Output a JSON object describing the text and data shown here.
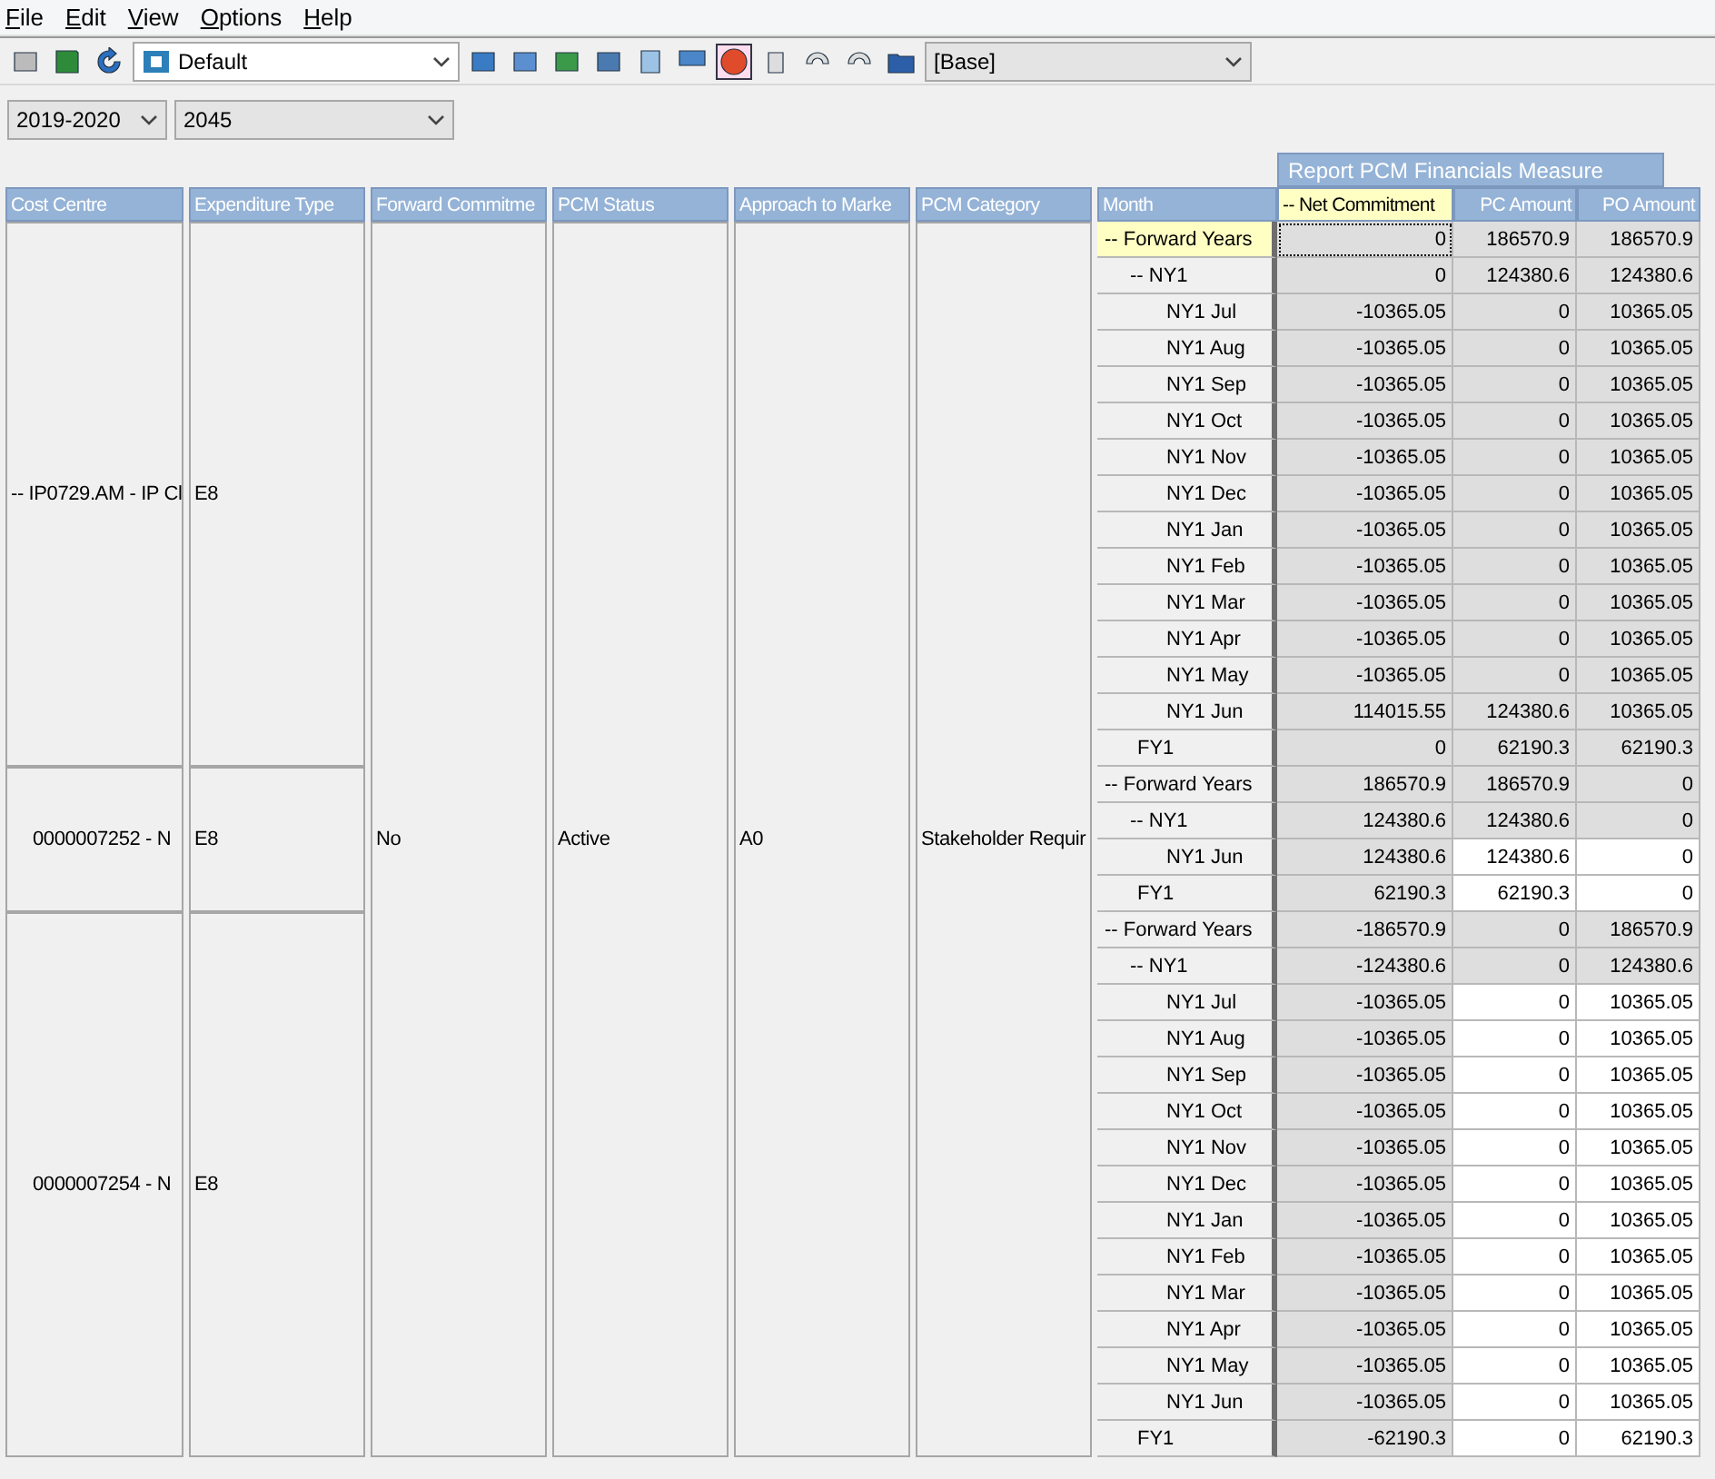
{
  "menu": [
    "File",
    "Edit",
    "View",
    "Options",
    "Help"
  ],
  "toolbar": {
    "view": "Default",
    "scenario": "[Base]"
  },
  "filters": [
    "2019-2020",
    "2045"
  ],
  "measure_header": "Report PCM Financials Measure",
  "columns": [
    "Cost Centre",
    "Expenditure Type",
    "Forward Commitme",
    "PCM Status",
    "Approach to Marke",
    "PCM Category",
    "Month",
    "-- Net Commitment",
    "PC Amount",
    "PO Amount"
  ],
  "forward_commitment": "No",
  "pcm_status": "Active",
  "approach": "A0",
  "category": "Stakeholder Requir",
  "groups": [
    {
      "cost_centre": "-- IP0729.AM - IP Cl",
      "expenditure_type": "E8",
      "rows": [
        {
          "kind": "total",
          "month": "-- Forward Years",
          "net": "0",
          "pc": "186570.9",
          "po": "186570.9",
          "editable": false,
          "selected": true
        },
        {
          "kind": "year",
          "month": "-- NY1",
          "net": "0",
          "pc": "124380.6",
          "po": "124380.6",
          "editable": false,
          "selected": false
        },
        {
          "kind": "month",
          "month": "NY1 Jul",
          "net": "-10365.05",
          "pc": "0",
          "po": "10365.05",
          "editable": false,
          "selected": false
        },
        {
          "kind": "month",
          "month": "NY1 Aug",
          "net": "-10365.05",
          "pc": "0",
          "po": "10365.05",
          "editable": false,
          "selected": false
        },
        {
          "kind": "month",
          "month": "NY1 Sep",
          "net": "-10365.05",
          "pc": "0",
          "po": "10365.05",
          "editable": false,
          "selected": false
        },
        {
          "kind": "month",
          "month": "NY1 Oct",
          "net": "-10365.05",
          "pc": "0",
          "po": "10365.05",
          "editable": false,
          "selected": false
        },
        {
          "kind": "month",
          "month": "NY1 Nov",
          "net": "-10365.05",
          "pc": "0",
          "po": "10365.05",
          "editable": false,
          "selected": false
        },
        {
          "kind": "month",
          "month": "NY1 Dec",
          "net": "-10365.05",
          "pc": "0",
          "po": "10365.05",
          "editable": false,
          "selected": false
        },
        {
          "kind": "month",
          "month": "NY1 Jan",
          "net": "-10365.05",
          "pc": "0",
          "po": "10365.05",
          "editable": false,
          "selected": false
        },
        {
          "kind": "month",
          "month": "NY1 Feb",
          "net": "-10365.05",
          "pc": "0",
          "po": "10365.05",
          "editable": false,
          "selected": false
        },
        {
          "kind": "month",
          "month": "NY1 Mar",
          "net": "-10365.05",
          "pc": "0",
          "po": "10365.05",
          "editable": false,
          "selected": false
        },
        {
          "kind": "month",
          "month": "NY1 Apr",
          "net": "-10365.05",
          "pc": "0",
          "po": "10365.05",
          "editable": false,
          "selected": false
        },
        {
          "kind": "month",
          "month": "NY1 May",
          "net": "-10365.05",
          "pc": "0",
          "po": "10365.05",
          "editable": false,
          "selected": false
        },
        {
          "kind": "month",
          "month": "NY1 Jun",
          "net": "114015.55",
          "pc": "124380.6",
          "po": "10365.05",
          "editable": false,
          "selected": false
        },
        {
          "kind": "fy",
          "month": "FY1",
          "net": "0",
          "pc": "62190.3",
          "po": "62190.3",
          "editable": false,
          "selected": false
        }
      ]
    },
    {
      "cost_centre": "0000007252 - N",
      "expenditure_type": "E8",
      "rows": [
        {
          "kind": "total",
          "month": "-- Forward Years",
          "net": "186570.9",
          "pc": "186570.9",
          "po": "0",
          "editable": false,
          "selected": false
        },
        {
          "kind": "year",
          "month": "-- NY1",
          "net": "124380.6",
          "pc": "124380.6",
          "po": "0",
          "editable": false,
          "selected": false
        },
        {
          "kind": "month",
          "month": "NY1 Jun",
          "net": "124380.6",
          "pc": "124380.6",
          "po": "0",
          "editable": true,
          "selected": false
        },
        {
          "kind": "fy",
          "month": "FY1",
          "net": "62190.3",
          "pc": "62190.3",
          "po": "0",
          "editable": true,
          "selected": false
        }
      ]
    },
    {
      "cost_centre": "0000007254 - N",
      "expenditure_type": "E8",
      "rows": [
        {
          "kind": "total",
          "month": "-- Forward Years",
          "net": "-186570.9",
          "pc": "0",
          "po": "186570.9",
          "editable": false,
          "selected": false
        },
        {
          "kind": "year",
          "month": "-- NY1",
          "net": "-124380.6",
          "pc": "0",
          "po": "124380.6",
          "editable": false,
          "selected": false
        },
        {
          "kind": "month",
          "month": "NY1 Jul",
          "net": "-10365.05",
          "pc": "0",
          "po": "10365.05",
          "editable": true,
          "selected": false
        },
        {
          "kind": "month",
          "month": "NY1 Aug",
          "net": "-10365.05",
          "pc": "0",
          "po": "10365.05",
          "editable": true,
          "selected": false
        },
        {
          "kind": "month",
          "month": "NY1 Sep",
          "net": "-10365.05",
          "pc": "0",
          "po": "10365.05",
          "editable": true,
          "selected": false
        },
        {
          "kind": "month",
          "month": "NY1 Oct",
          "net": "-10365.05",
          "pc": "0",
          "po": "10365.05",
          "editable": true,
          "selected": false
        },
        {
          "kind": "month",
          "month": "NY1 Nov",
          "net": "-10365.05",
          "pc": "0",
          "po": "10365.05",
          "editable": true,
          "selected": false
        },
        {
          "kind": "month",
          "month": "NY1 Dec",
          "net": "-10365.05",
          "pc": "0",
          "po": "10365.05",
          "editable": true,
          "selected": false
        },
        {
          "kind": "month",
          "month": "NY1 Jan",
          "net": "-10365.05",
          "pc": "0",
          "po": "10365.05",
          "editable": true,
          "selected": false
        },
        {
          "kind": "month",
          "month": "NY1 Feb",
          "net": "-10365.05",
          "pc": "0",
          "po": "10365.05",
          "editable": true,
          "selected": false
        },
        {
          "kind": "month",
          "month": "NY1 Mar",
          "net": "-10365.05",
          "pc": "0",
          "po": "10365.05",
          "editable": true,
          "selected": false
        },
        {
          "kind": "month",
          "month": "NY1 Apr",
          "net": "-10365.05",
          "pc": "0",
          "po": "10365.05",
          "editable": true,
          "selected": false
        },
        {
          "kind": "month",
          "month": "NY1 May",
          "net": "-10365.05",
          "pc": "0",
          "po": "10365.05",
          "editable": true,
          "selected": false
        },
        {
          "kind": "month",
          "month": "NY1 Jun",
          "net": "-10365.05",
          "pc": "0",
          "po": "10365.05",
          "editable": true,
          "selected": false
        },
        {
          "kind": "fy",
          "month": "FY1",
          "net": "-62190.3",
          "pc": "0",
          "po": "62190.3",
          "editable": true,
          "selected": false
        }
      ]
    }
  ]
}
